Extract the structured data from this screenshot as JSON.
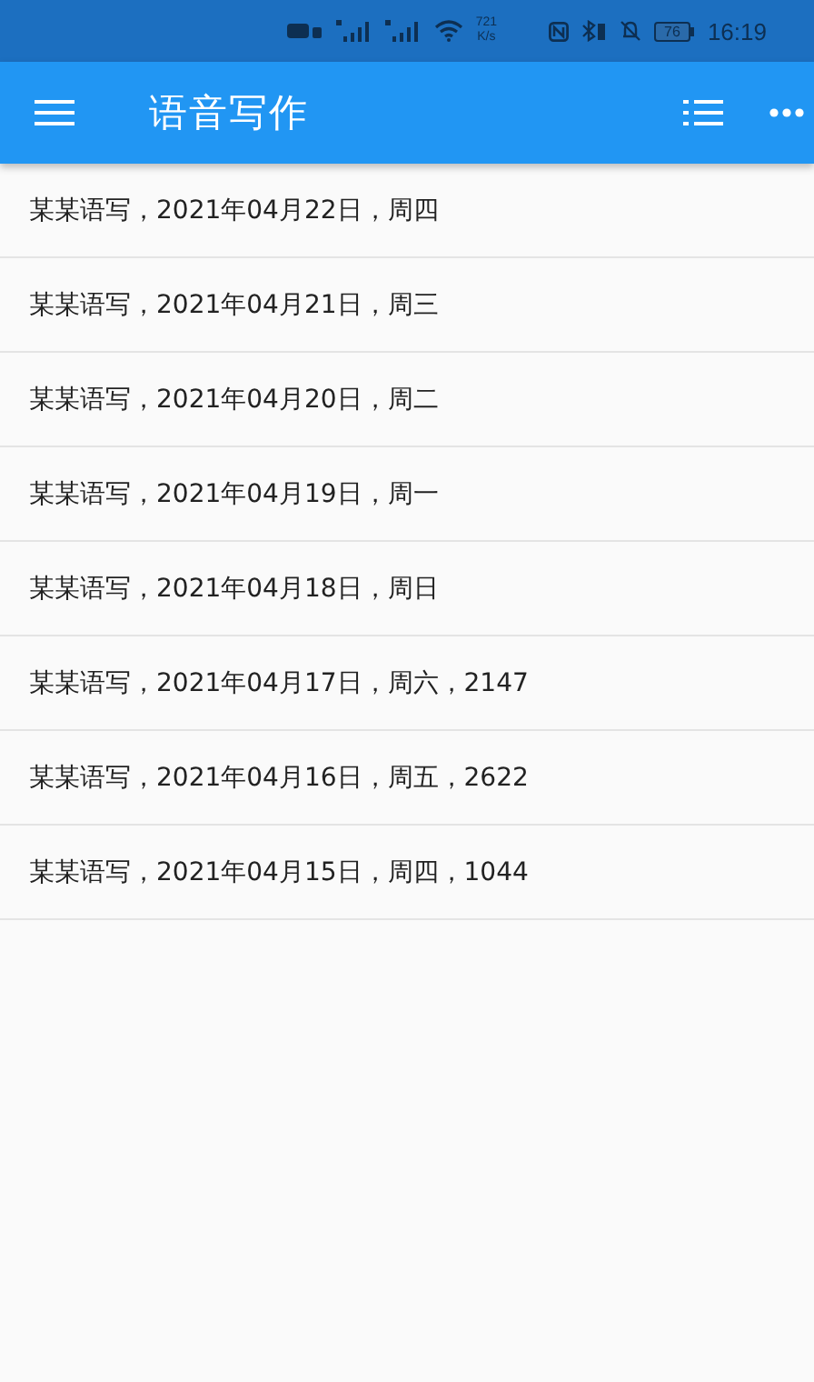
{
  "status_bar": {
    "network_speed": "721",
    "speed_unit": "K/s",
    "battery": "76",
    "time": "16:19"
  },
  "app_bar": {
    "title": "语音写作"
  },
  "entries": [
    {
      "label": "某某语写，2021年04月22日，周四"
    },
    {
      "label": "某某语写，2021年04月21日，周三"
    },
    {
      "label": "某某语写，2021年04月20日，周二"
    },
    {
      "label": "某某语写，2021年04月19日，周一"
    },
    {
      "label": "某某语写，2021年04月18日，周日"
    },
    {
      "label": "某某语写，2021年04月17日，周六，2147"
    },
    {
      "label": "某某语写，2021年04月16日，周五，2622"
    },
    {
      "label": "某某语写，2021年04月15日，周四，1044"
    }
  ]
}
